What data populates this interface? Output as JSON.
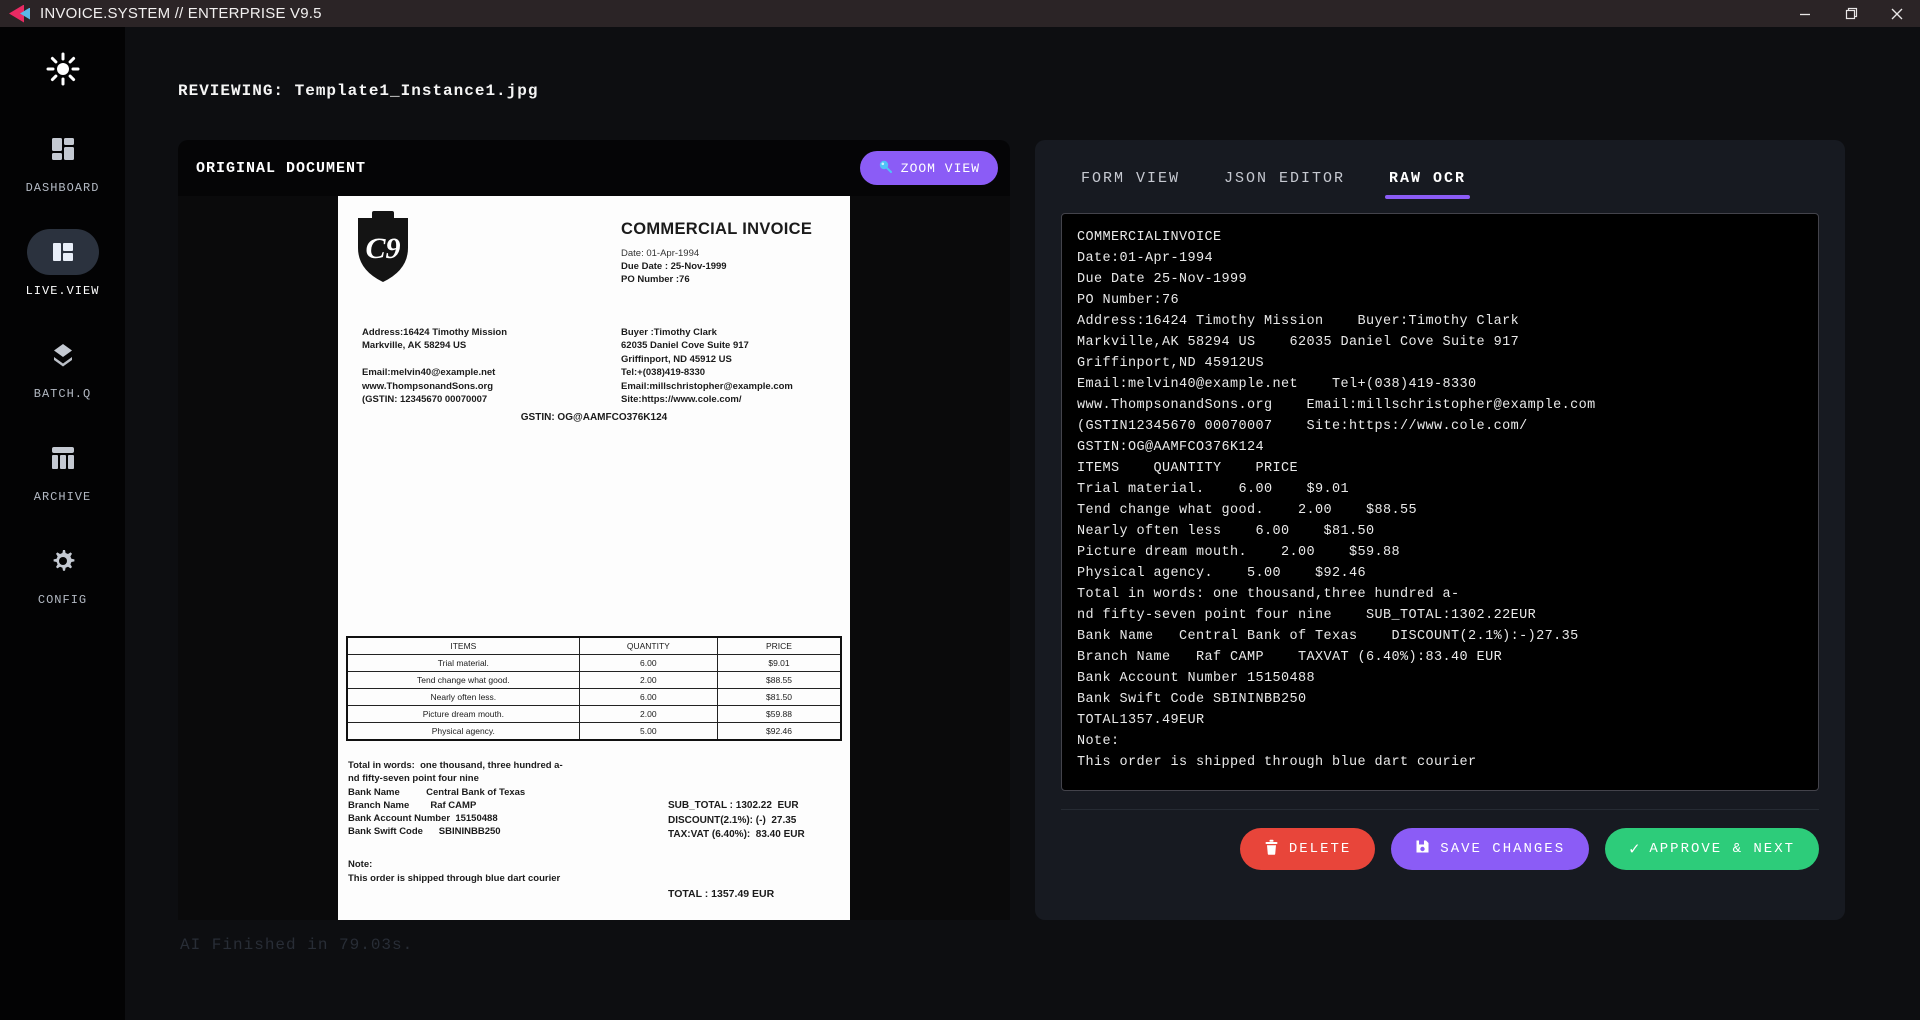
{
  "window": {
    "title": "INVOICE.SYSTEM // ENTERPRISE V9.5"
  },
  "sidebar": {
    "items": [
      {
        "label": "DASHBOARD",
        "active": false
      },
      {
        "label": "LIVE.VIEW",
        "active": true
      },
      {
        "label": "BATCH.Q",
        "active": false
      },
      {
        "label": "ARCHIVE",
        "active": false
      },
      {
        "label": "CONFIG",
        "active": false
      }
    ]
  },
  "header": {
    "reviewing": "REVIEWING: Template1_Instance1.jpg"
  },
  "document_panel": {
    "title": "ORIGINAL DOCUMENT",
    "zoom_button_label": "ZOOM VIEW",
    "invoice": {
      "logo_text": "C9",
      "title": "COMMERCIAL INVOICE",
      "date": "Date: 01-Apr-1994",
      "due_date": "Due Date : 25-Nov-1999",
      "po_number": "PO Number :76",
      "seller_lines": [
        "Address:16424 Timothy Mission",
        "Markville, AK 58294 US",
        "",
        "Email:melvin40@example.net",
        "www.ThompsonandSons.org",
        "(GSTIN: 12345670 00070007"
      ],
      "buyer_lines": [
        "Buyer :Timothy Clark",
        "62035 Daniel Cove Suite 917",
        "Griffinport, ND 45912 US",
        "Tel:+(038)419-8330",
        "Email:millschristopher@example.com",
        "Site:https://www.cole.com/"
      ],
      "gstin": "GSTIN: OG@AAMFCO376K124",
      "table": {
        "headers": [
          "ITEMS",
          "QUANTITY",
          "PRICE"
        ],
        "rows": [
          [
            "Trial material.",
            "6.00",
            "$9.01"
          ],
          [
            "Tend change what good.",
            "2.00",
            "$88.55"
          ],
          [
            "Nearly often less.",
            "6.00",
            "$81.50"
          ],
          [
            "Picture dream mouth.",
            "2.00",
            "$59.88"
          ],
          [
            "Physical agency.",
            "5.00",
            "$92.46"
          ]
        ]
      },
      "totals_left_lines": [
        "Total in words:  one thousand, three hundred a-",
        "nd fifty-seven point four nine",
        "Bank Name          Central Bank of Texas",
        "Branch Name        Raf CAMP",
        "Bank Account Number  15150488",
        "Bank Swift Code      SBININBB250"
      ],
      "totals_right_lines": [
        "SUB_TOTAL : 1302.22  EUR",
        "DISCOUNT(2.1%): (-)  27.35",
        "TAX:VAT (6.40%):  83.40 EUR"
      ],
      "grand_total": "TOTAL : 1357.49 EUR",
      "note_label": "Note:",
      "note_text": "This order is shipped through blue dart courier"
    }
  },
  "ocr_panel": {
    "tabs": [
      {
        "label": "FORM VIEW",
        "active": false
      },
      {
        "label": "JSON EDITOR",
        "active": false
      },
      {
        "label": "RAW OCR",
        "active": true
      }
    ],
    "ocr_lines": [
      "COMMERCIALINVOICE",
      "Date:01-Apr-1994",
      "Due Date 25-Nov-1999",
      "PO Number:76",
      "Address:16424 Timothy Mission    Buyer:Timothy Clark",
      "Markville,AK 58294 US    62035 Daniel Cove Suite 917",
      "Griffinport,ND 45912US",
      "Email:melvin40@example.net    Tel+(038)419-8330",
      "www.ThompsonandSons.org    Email:millschristopher@example.com",
      "(GSTIN12345670 00070007    Site:https://www.cole.com/",
      "GSTIN:OG@AAMFCO376K124",
      "ITEMS    QUANTITY    PRICE",
      "Trial material.    6.00    $9.01",
      "Tend change what good.    2.00    $88.55",
      "Nearly often less    6.00    $81.50",
      "Picture dream mouth.    2.00    $59.88",
      "Physical agency.    5.00    $92.46",
      "Total in words: one thousand,three hundred a-",
      "nd fifty-seven point four nine    SUB_TOTAL:1302.22EUR",
      "Bank Name   Central Bank of Texas    DISCOUNT(2.1%):-)27.35",
      "Branch Name   Raf CAMP    TAXVAT (6.40%):83.40 EUR",
      "Bank Account Number 15150488",
      "Bank Swift Code SBININBB250",
      "TOTAL1357.49EUR",
      "Note:",
      "This order is shipped through blue dart courier"
    ],
    "buttons": {
      "delete": "DELETE",
      "save": "SAVE CHANGES",
      "approve": "APPROVE & NEXT"
    }
  },
  "status": {
    "ai_finished": "AI Finished in 79.03s."
  },
  "colors": {
    "accent_purple": "#8b5cf6",
    "danger_red": "#e8453a",
    "success_green": "#2dcc7a",
    "logo_pink": "#e82a63",
    "logo_blue": "#5bb8e8",
    "panel_bg": "#171a21",
    "ocr_bg": "#000000"
  }
}
